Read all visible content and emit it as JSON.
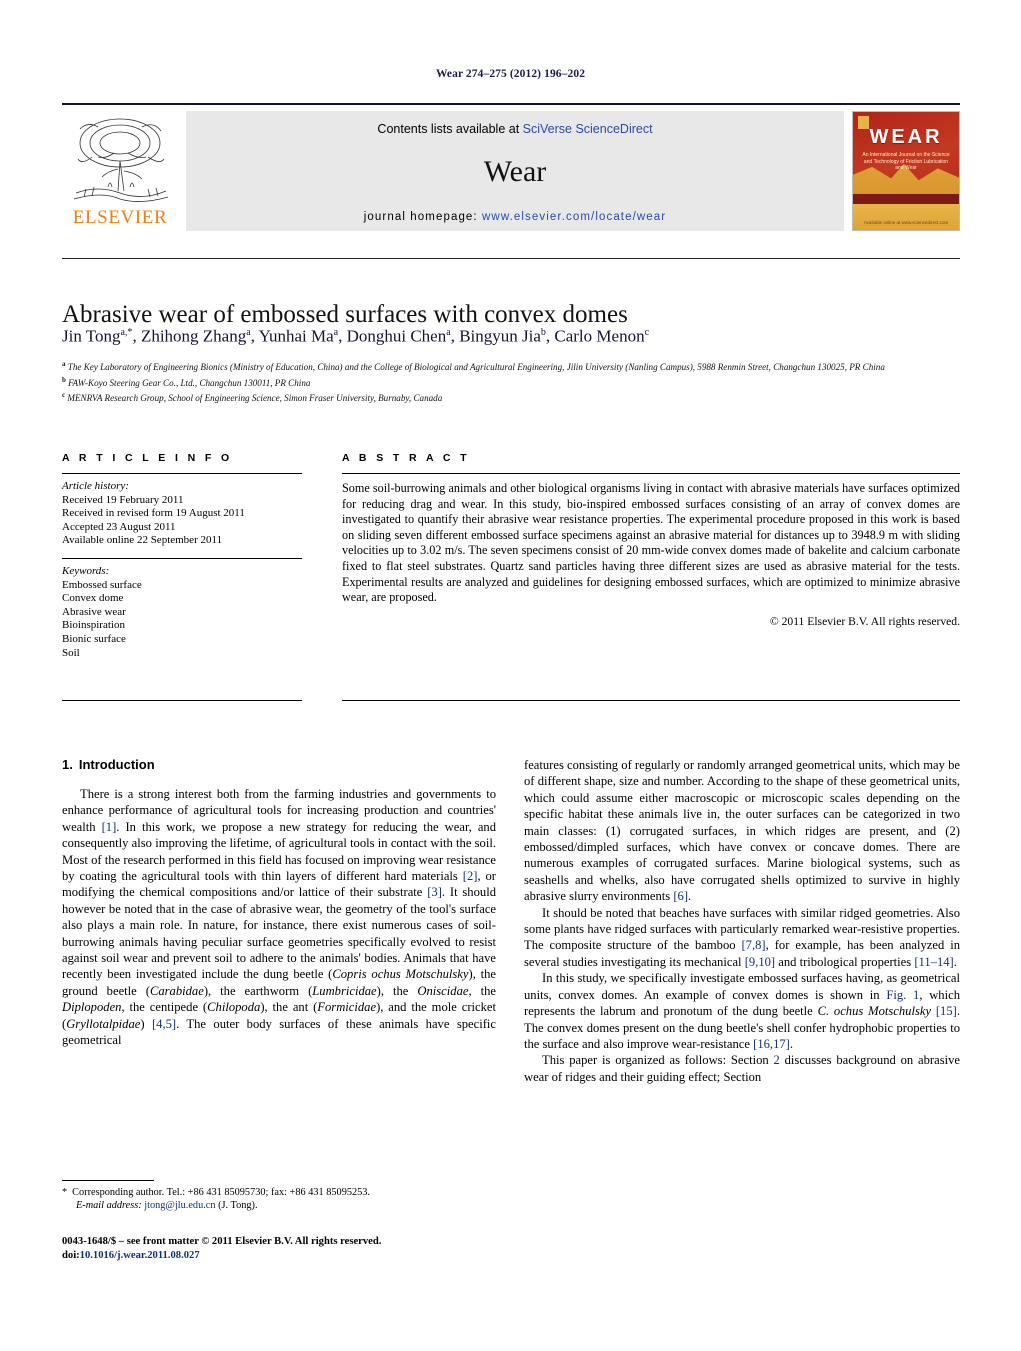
{
  "running_head": "Wear 274–275 (2012) 196–202",
  "masthead": {
    "publisher_name": "ELSEVIER",
    "contents_prefix": "Contents lists available at ",
    "contents_link": "SciVerse ScienceDirect",
    "journal_title": "Wear",
    "homepage_label": "journal homepage:",
    "homepage_url": "www.elsevier.com/locate/wear",
    "cover": {
      "title": "WEAR",
      "subtitle": "An International Journal on the Science and Technology of Friction Lubrication and Wear",
      "footer": "Available online at www.sciencedirect.com"
    }
  },
  "article": {
    "title": "Abrasive wear of embossed surfaces with convex domes",
    "authors": [
      {
        "name": "Jin Tong",
        "sup": "a,*"
      },
      {
        "name": "Zhihong Zhang",
        "sup": "a"
      },
      {
        "name": "Yunhai Ma",
        "sup": "a"
      },
      {
        "name": "Donghui Chen",
        "sup": "a"
      },
      {
        "name": "Bingyun Jia",
        "sup": "b"
      },
      {
        "name": "Carlo Menon",
        "sup": "c"
      }
    ],
    "affiliations": [
      {
        "sup": "a",
        "text": "The Key Laboratory of Engineering Bionics (Ministry of Education, China) and the College of Biological and Agricultural Engineering, Jilin University (Nanling Campus), 5988 Renmin Street, Changchun 130025, PR China"
      },
      {
        "sup": "b",
        "text": "FAW-Koyo Steering Gear Co., Ltd., Changchun 130011, PR China"
      },
      {
        "sup": "c",
        "text": "MENRVA Research Group, School of Engineering Science, Simon Fraser University, Burnaby, Canada"
      }
    ]
  },
  "article_info": {
    "heading": "A R T I C L E   I N F O",
    "history_label": "Article history:",
    "history": [
      "Received 19 February 2011",
      "Received in revised form 19 August 2011",
      "Accepted 23 August 2011",
      "Available online 22 September 2011"
    ],
    "keywords_label": "Keywords:",
    "keywords": [
      "Embossed surface",
      "Convex dome",
      "Abrasive wear",
      "Bioinspiration",
      "Bionic surface",
      "Soil"
    ]
  },
  "abstract": {
    "heading": "A B S T R A C T",
    "text": "Some soil-burrowing animals and other biological organisms living in contact with abrasive materials have surfaces optimized for reducing drag and wear. In this study, bio-inspired embossed surfaces consisting of an array of convex domes are investigated to quantify their abrasive wear resistance properties. The experimental procedure proposed in this work is based on sliding seven different embossed surface specimens against an abrasive material for distances up to 3948.9 m with sliding velocities up to 3.02 m/s. The seven specimens consist of 20 mm-wide convex domes made of bakelite and calcium carbonate fixed to flat steel substrates. Quartz sand particles having three different sizes are used as abrasive material for the tests. Experimental results are analyzed and guidelines for designing embossed surfaces, which are optimized to minimize abrasive wear, are proposed.",
    "copyright": "© 2011 Elsevier B.V. All rights reserved."
  },
  "body": {
    "section_number": "1.",
    "section_title": "Introduction",
    "left_paragraphs": [
      "There is a strong interest both from the farming industries and governments to enhance performance of agricultural tools for increasing production and countries' wealth [1]. In this work, we propose a new strategy for reducing the wear, and consequently also improving the lifetime, of agricultural tools in contact with the soil. Most of the research performed in this field has focused on improving wear resistance by coating the agricultural tools with thin layers of different hard materials [2], or modifying the chemical compositions and/or lattice of their substrate [3]. It should however be noted that in the case of abrasive wear, the geometry of the tool's surface also plays a main role. In nature, for instance, there exist numerous cases of soil-burrowing animals having peculiar surface geometries specifically evolved to resist against soil wear and prevent soil to adhere to the animals' bodies. Animals that have recently been investigated include the dung beetle (Copris ochus Motschulsky), the ground beetle (Carabidae), the earthworm (Lumbricidae), the Oniscidae, the Diplopoden, the centipede (Chilopoda), the ant (Formicidae), and the mole cricket (Gryllotalpidae) [4,5]. The outer body surfaces of these animals have specific geometrical"
    ],
    "right_paragraphs": [
      "features consisting of regularly or randomly arranged geometrical units, which may be of different shape, size and number. According to the shape of these geometrical units, which could assume either macroscopic or microscopic scales depending on the specific habitat these animals live in, the outer surfaces can be categorized in two main classes: (1) corrugated surfaces, in which ridges are present, and (2) embossed/dimpled surfaces, which have convex or concave domes. There are numerous examples of corrugated surfaces. Marine biological systems, such as seashells and whelks, also have corrugated shells optimized to survive in highly abrasive slurry environments [6].",
      "It should be noted that beaches have surfaces with similar ridged geometries. Also some plants have ridged surfaces with particularly remarked wear-resistive properties. The composite structure of the bamboo [7,8], for example, has been analyzed in several studies investigating its mechanical [9,10] and tribological properties [11–14].",
      "In this study, we specifically investigate embossed surfaces having, as geometrical units, convex domes. An example of convex domes is shown in Fig. 1, which represents the labrum and pronotum of the dung beetle C. ochus Motschulsky [15]. The convex domes present on the dung beetle's shell confer hydrophobic properties to the surface and also improve wear-resistance [16,17].",
      "This paper is organized as follows: Section 2 discusses background on abrasive wear of ridges and their guiding effect; Section"
    ]
  },
  "footnote": {
    "star": "*",
    "corresponding": "Corresponding author. Tel.: +86 431 85095730; fax: +86 431 85095253.",
    "email_label": "E-mail address:",
    "email": "jtong@jlu.edu.cn",
    "email_owner": "(J. Tong)."
  },
  "imprint": {
    "line1": "0043-1648/$ – see front matter © 2011 Elsevier B.V. All rights reserved.",
    "doi_label": "doi:",
    "doi": "10.1016/j.wear.2011.08.027"
  }
}
